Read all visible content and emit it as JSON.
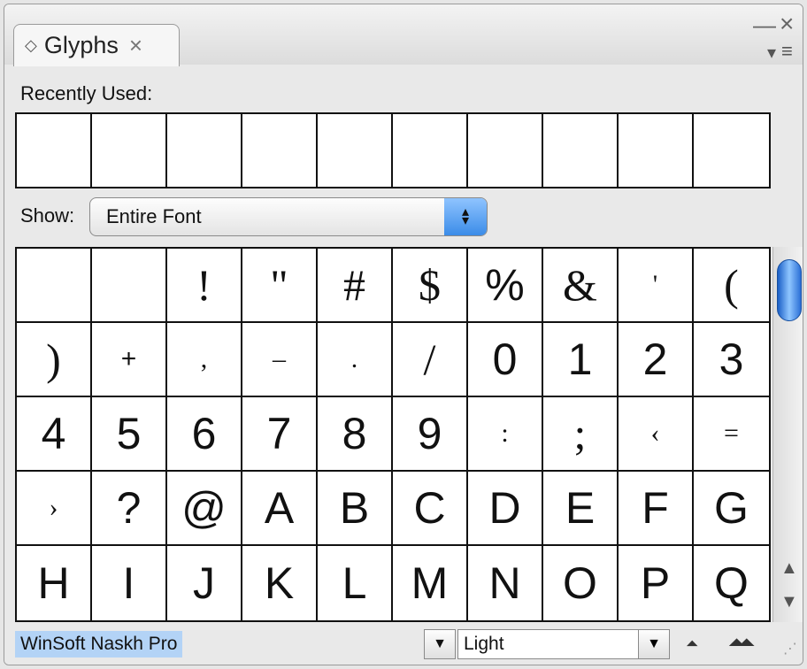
{
  "panel": {
    "tab_label": "Glyphs",
    "tab_close_icon": "×",
    "tab_arrows_icon": "◇",
    "minimize_icon": "—",
    "close_icon": "×"
  },
  "recently_used": {
    "label": "Recently Used:",
    "cells": [
      "",
      "",
      "",
      "",
      "",
      "",
      "",
      "",
      "",
      ""
    ]
  },
  "show": {
    "label": "Show:",
    "value": "Entire Font"
  },
  "glyphs": [
    " ",
    " ",
    "!",
    "\"",
    "#",
    "$",
    "%",
    "&",
    "'",
    "(",
    ")",
    "+",
    ",",
    "–",
    ".",
    "/",
    "0",
    "1",
    "2",
    "3",
    "4",
    "5",
    "6",
    "7",
    "8",
    "9",
    ":",
    ";",
    "‹",
    "=",
    "›",
    "?",
    "@",
    "A",
    "B",
    "C",
    "D",
    "E",
    "F",
    "G",
    "H",
    "I",
    "J",
    "K",
    "L",
    "M",
    "N",
    "O",
    "P",
    "Q"
  ],
  "bottom": {
    "font_name": "WinSoft Naskh Pro",
    "font_style": "Light"
  },
  "colors": {
    "scroll_thumb": "#3b8ce8",
    "font_name_highlight": "#b3d3f6"
  }
}
